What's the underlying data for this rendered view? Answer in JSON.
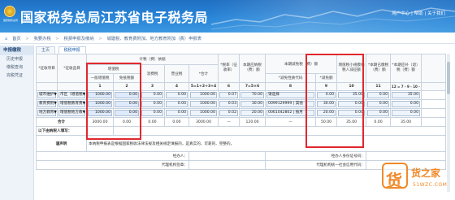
{
  "header": {
    "site_title": "国家税务总局江苏省电子税务局",
    "emblem_text": "国家税务总局",
    "links": [
      "信用评价",
      "|",
      "退出"
    ],
    "user_area": "用户中心 | 帮助 | 关于我们"
  },
  "breadcrumb": [
    "首页",
    ">",
    "我要办税",
    ">",
    "税费申报及缴纳",
    ">",
    "城建税、教育费附加、地方教育附加（费）申报表"
  ],
  "sidebar": {
    "head": "申报缴税",
    "items": [
      "历史申报",
      "缴税查询",
      "完税凭证"
    ]
  },
  "tabs": [
    "主页",
    "税税申报"
  ],
  "table": {
    "header": {
      "col_tax_item": "*征收项目",
      "col_tax_subitem": "*征收品目",
      "group_basis": "计税（费）依据",
      "group_vat": "增值税",
      "vat_general": "一般增值税",
      "vat_exempt": "免抵税额",
      "consumption_tax": "消费税",
      "business_tax": "营业税",
      "total": "*合计",
      "rate": "*税率（征收率）",
      "payable": "本期应纳税（费）额",
      "reduction_group": "本期减免税（费）额",
      "reduction_code": "*减免性质代码",
      "reduction_amount": "*减免额",
      "small_scale": "增值税小规模纳税人减征额",
      "paid": "*本期已缴税（费）额",
      "refund": "*本期应补（退）税（费）额"
    },
    "numbers": [
      "1",
      "2",
      "3",
      "4",
      "5=1+2+3+4",
      "6",
      "7=5×6",
      "8",
      "9",
      "10",
      "11",
      "12 = 7 - 9 - 10 - 11"
    ],
    "rows": [
      {
        "item": "城市维护▼",
        "subitem": "市区（增值税▼",
        "vat_general": "1000.00",
        "vat_exempt": "0.00",
        "consumption": "0.00",
        "business": "0.00",
        "total": "1000.00",
        "rate": "0.07",
        "payable": "70.00",
        "code": "请选择",
        "reduction": "0.00",
        "small_scale": "35.00",
        "paid": "0.00",
        "refund": "35.00"
      },
      {
        "item": "教育费附▼",
        "subitem": "增值税教育费▼",
        "vat_general": "1000.00",
        "vat_exempt": "0.00",
        "consumption": "0.00",
        "business": "0.00",
        "total": "1000.00",
        "rate": "0.03",
        "payable": "30.00",
        "code": "0099129999 | 其他",
        "reduction": "30.00",
        "small_scale": "0.00",
        "paid": "0.00",
        "refund": "0.00"
      },
      {
        "item": "地方教育▼",
        "subitem": "增值税地方教▼",
        "vat_general": "1000.00",
        "vat_exempt": "0.00",
        "consumption": "0.00",
        "business": "0.00",
        "total": "1000.00",
        "rate": "0.02",
        "payable": "20.00",
        "code": "0061042802 | 按月",
        "reduction": "20.00",
        "small_scale": "0.00",
        "paid": "0.00",
        "refund": "0.00"
      }
    ],
    "total_row": {
      "label": "合计",
      "vat_general": "3000.00",
      "vat_exempt": "0.00",
      "consumption": "0.00",
      "business": "0.00",
      "total": "3000.00",
      "rate": "—",
      "payable": "120.00",
      "code": "—",
      "reduction": "50.00",
      "small_scale": "35.00",
      "paid": "0.00",
      "refund": "35.00"
    },
    "filler_label": "以下由纳税人填写：",
    "declaration_label": "谨声明",
    "declaration_text": "本纳税申报表是根据国家税收法律法规及相关规定填报的，是真实的、可靠的、完整的。",
    "agent_row": {
      "handler_label": "经办人：",
      "handler_id_label": "经办人身份证号码：",
      "agent_org_label": "代理机构签章：",
      "agent_code_label": "代理机构统一社会信用代码："
    }
  },
  "watermark": {
    "glyph": "货",
    "title": "货之家",
    "url": "51WZC.COM"
  },
  "colors": {
    "header_blue": "#2a86d8",
    "highlight_red": "#e0282e",
    "watermark_orange": "#f08a2a"
  }
}
